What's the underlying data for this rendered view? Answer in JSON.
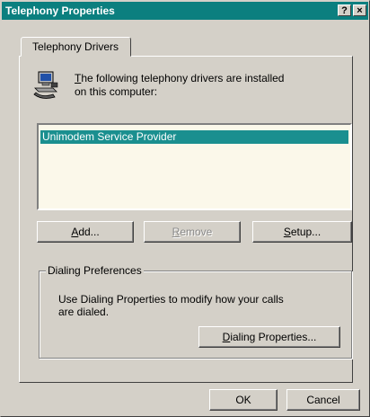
{
  "window": {
    "title": "Telephony Properties",
    "help_glyph": "?",
    "close_glyph": "×"
  },
  "tabs": [
    {
      "label": "Telephony Drivers"
    }
  ],
  "drivers": {
    "intro_line1_accel": "T",
    "intro_line1_rest": "he following telephony drivers are installed",
    "intro_line2": "on this computer:",
    "items": [
      {
        "name": "Unimodem Service Provider",
        "selected": true
      }
    ],
    "buttons": {
      "add": {
        "accel": "A",
        "rest": "dd..."
      },
      "remove": {
        "accel": "R",
        "rest": "emove"
      },
      "setup": {
        "accel": "S",
        "rest": "etup..."
      }
    }
  },
  "dialing": {
    "group_label": "Dialing Preferences",
    "text_line1": "Use Dialing Properties to modify how your calls",
    "text_line2": "are dialed.",
    "button": {
      "accel": "D",
      "rest": "ialing Properties..."
    }
  },
  "footer": {
    "ok": "OK",
    "cancel": "Cancel"
  },
  "colors": {
    "titlebar": "#0b7f7f",
    "selection": "#1a8f8f",
    "face": "#d4d0c8",
    "listbox_bg": "#fbf8ea"
  },
  "icons": {
    "drivers": "computer-telephony-icon"
  }
}
